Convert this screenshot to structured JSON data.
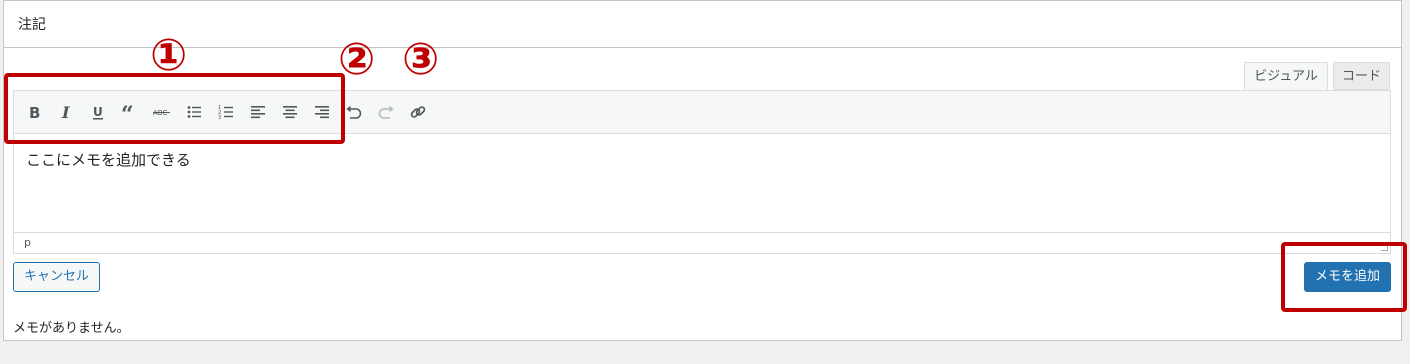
{
  "panel": {
    "title": "注記"
  },
  "annotations": {
    "n1": "①",
    "n2": "②",
    "n3": "③",
    "highlight_color": "#c00000"
  },
  "tabs": [
    {
      "label": "ビジュアル",
      "active": true
    },
    {
      "label": "コード",
      "active": false
    }
  ],
  "toolbar": [
    {
      "icon": "bold-icon"
    },
    {
      "icon": "italic-icon"
    },
    {
      "icon": "underline-icon"
    },
    {
      "icon": "blockquote-icon"
    },
    {
      "icon": "strikethrough-icon"
    },
    {
      "icon": "bullet-list-icon"
    },
    {
      "icon": "numbered-list-icon"
    },
    {
      "icon": "align-left-icon"
    },
    {
      "icon": "align-center-icon"
    },
    {
      "icon": "align-right-icon"
    },
    {
      "icon": "undo-icon"
    },
    {
      "icon": "redo-icon"
    },
    {
      "icon": "link-icon"
    }
  ],
  "editor": {
    "content": "ここにメモを追加できる",
    "path": "p"
  },
  "buttons": {
    "cancel": "キャンセル",
    "add": "メモを追加"
  },
  "notes": {
    "empty": "メモがありません。"
  },
  "colors": {
    "primary": "#2271b1",
    "border": "#c3c4c7",
    "highlight": "#c00000"
  }
}
